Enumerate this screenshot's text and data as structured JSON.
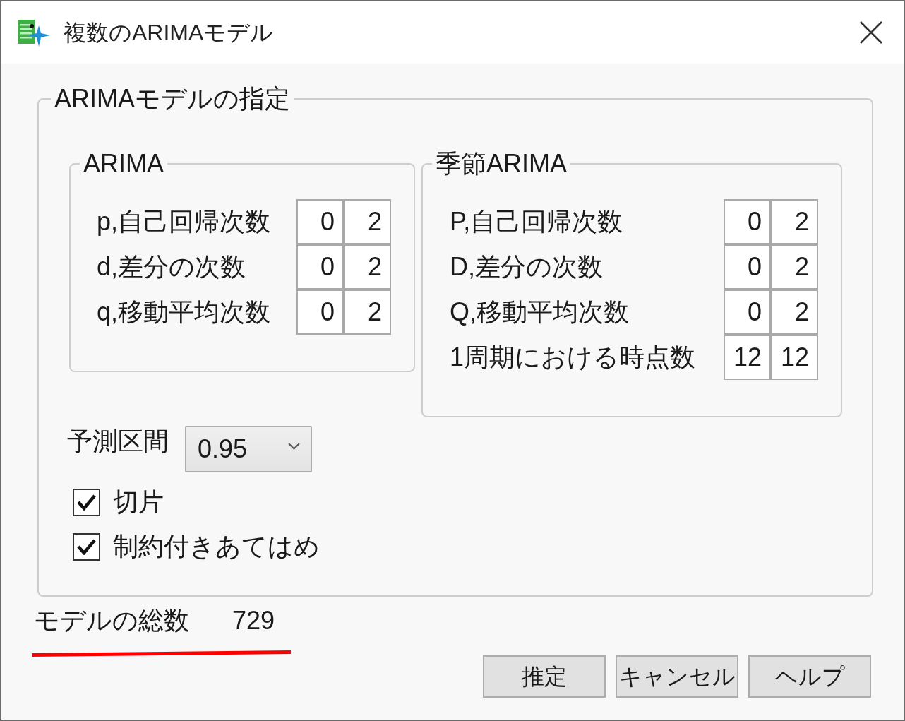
{
  "window": {
    "title": "複数のARIMAモデル"
  },
  "model_spec": {
    "title": "ARIMAモデルの指定",
    "groups": [
      {
        "kind": "nonseasonal",
        "title": "ARIMA",
        "rows": [
          {
            "label": "p,自己回帰次数",
            "values": [
              "0",
              "2"
            ]
          },
          {
            "label": "d,差分の次数",
            "values": [
              "0",
              "2"
            ]
          },
          {
            "label": "q,移動平均次数",
            "values": [
              "0",
              "2"
            ]
          }
        ]
      },
      {
        "kind": "seasonal",
        "title": "季節ARIMA",
        "rows": [
          {
            "label": "P,自己回帰次数",
            "values": [
              "0",
              "2"
            ]
          },
          {
            "label": "D,差分の次数",
            "values": [
              "0",
              "2"
            ]
          },
          {
            "label": "Q,移動平均次数",
            "values": [
              "0",
              "2"
            ]
          },
          {
            "label": "1周期における時点数",
            "values": [
              "12",
              "12"
            ]
          }
        ]
      }
    ],
    "prediction_interval": {
      "label": "予測区間",
      "value": "0.95"
    },
    "options": [
      {
        "label": "切片",
        "checked": true
      },
      {
        "label": "制約付きあてはめ",
        "checked": true
      }
    ]
  },
  "model_count": {
    "label": "モデルの総数",
    "value": "729"
  },
  "buttons": [
    "推定",
    "キャンセル",
    "ヘルプ"
  ]
}
